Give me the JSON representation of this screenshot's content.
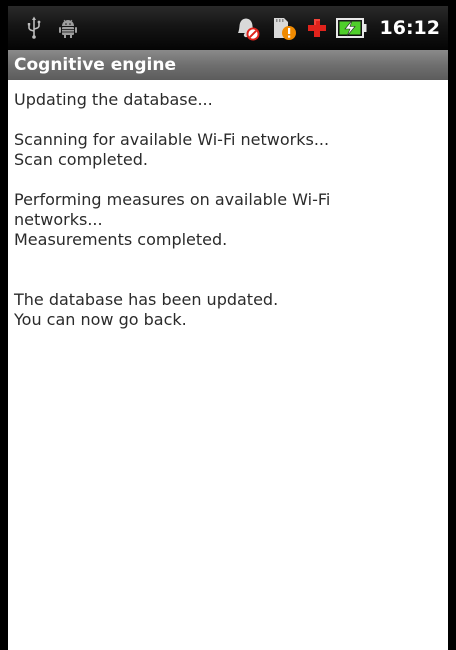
{
  "status_bar": {
    "time": "16:12",
    "icons_left": [
      "usb-icon",
      "android-debug-icon"
    ],
    "icons_right": [
      "silent-alarm-icon",
      "sd-card-warning-icon",
      "medical-cross-icon",
      "battery-charging-icon"
    ],
    "colors": {
      "background": "#0a0a0a",
      "warning_orange": "#f08a00",
      "alert_red": "#e0231c",
      "battery_green": "#4fce2a"
    }
  },
  "app": {
    "title": "Cognitive engine"
  },
  "log": {
    "line_1": "Updating the database...",
    "line_2": "Scanning for available Wi-Fi networks...",
    "line_3": "Scan completed.",
    "line_4": "Performing measures on available Wi-Fi networks...",
    "line_5": "Measurements completed.",
    "line_6": "The database has been updated.",
    "line_7": "You can now go back."
  }
}
